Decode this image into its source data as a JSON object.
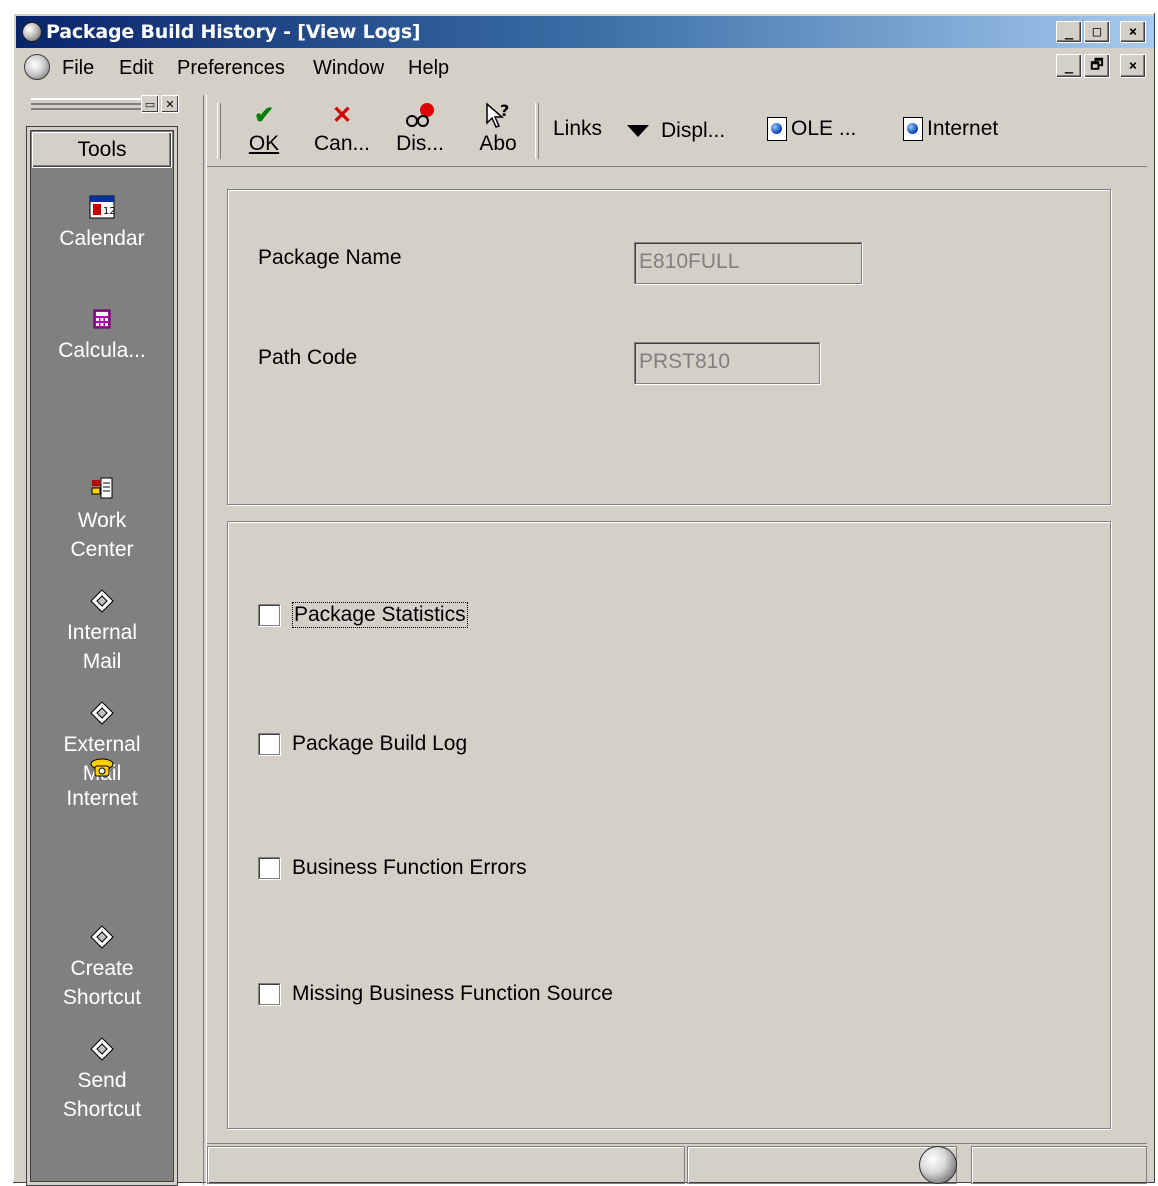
{
  "window": {
    "title": "Package Build History - [View Logs]",
    "caption_buttons": [
      "_",
      "□",
      "×"
    ]
  },
  "menubar": {
    "items": [
      "File",
      "Edit",
      "Preferences",
      "Window",
      "Help"
    ],
    "mdi_buttons": [
      "_",
      "🗗",
      "×"
    ]
  },
  "tools": {
    "header": "Tools",
    "items": [
      {
        "label": "Calendar",
        "icon": "calendar-icon"
      },
      {
        "label": "Calcula...",
        "icon": "calculator-icon"
      },
      {
        "label": "Work\nCenter",
        "icon": "work-center-icon"
      },
      {
        "label": "Internal\nMail",
        "icon": "shortcut-diamond-icon"
      },
      {
        "label": "External\nMail",
        "icon": "shortcut-diamond-icon"
      },
      {
        "label": "Internet",
        "icon": "phone-icon"
      },
      {
        "label": "Create\nShortcut",
        "icon": "shortcut-diamond-icon"
      },
      {
        "label": "Send\nShortcut",
        "icon": "shortcut-diamond-icon"
      }
    ]
  },
  "toolbar": {
    "buttons": [
      {
        "label": "OK",
        "icon": "check-icon",
        "color": "#008000"
      },
      {
        "label": "Can...",
        "icon": "cancel-x-icon",
        "color": "#d00000"
      },
      {
        "label": "Dis...",
        "icon": "display-glasses-icon",
        "color": "#e00000"
      },
      {
        "label": "Abo",
        "icon": "about-help-icon",
        "color": "#000000"
      }
    ],
    "links": "Links",
    "display": "Displ...",
    "ole": "OLE ...",
    "internet": "Internet"
  },
  "form": {
    "package_name_label": "Package Name",
    "package_name_value": "E810FULL",
    "path_code_label": "Path Code",
    "path_code_value": "PRST810"
  },
  "options": [
    {
      "label": "Package Statistics",
      "checked": false,
      "focused": true
    },
    {
      "label": "Package Build Log",
      "checked": false
    },
    {
      "label": "Business Function Errors",
      "checked": false
    },
    {
      "label": "Missing Business Function Source",
      "checked": false
    }
  ]
}
